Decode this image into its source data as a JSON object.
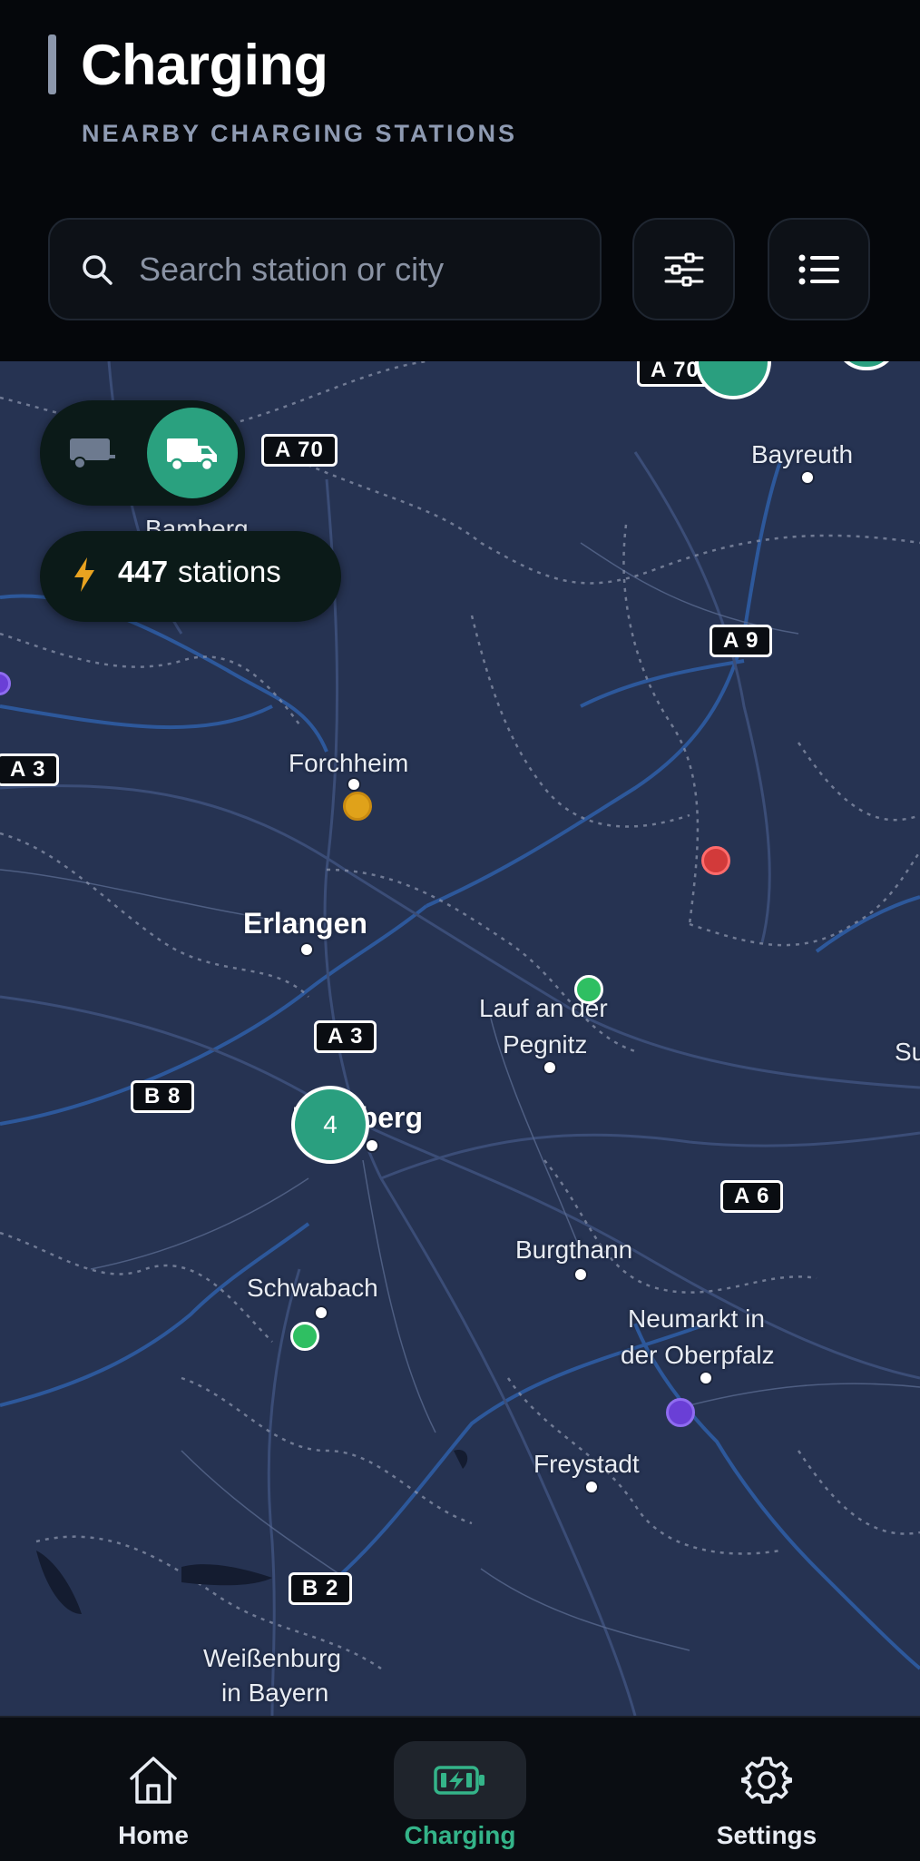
{
  "header": {
    "title": "Charging",
    "subtitle": "NEARBY CHARGING STATIONS"
  },
  "search": {
    "placeholder": "Search station or city",
    "value": ""
  },
  "toolbar": {
    "filter_icon": "sliders-icon",
    "list_icon": "list-icon"
  },
  "vehicle_toggle": {
    "options": [
      {
        "icon": "trailer-icon",
        "active": false
      },
      {
        "icon": "truck-icon",
        "active": true
      }
    ]
  },
  "station_count": {
    "value": "447",
    "label": "stations",
    "icon": "bolt-icon"
  },
  "map": {
    "cities": [
      "Bayreuth",
      "Bamberg",
      "Forchheim",
      "Erlangen",
      "Lauf an der",
      "Pegnitz",
      "Nürnberg",
      "Schwabach",
      "Burgthann",
      "Neumarkt in",
      "der Oberpfalz",
      "Freystadt",
      "Weißenburg",
      "in Bayern",
      "Su"
    ],
    "roads": [
      "A 70",
      "A 70",
      "A 9",
      "A 3",
      "A 3",
      "B 8",
      "A 6",
      "B 2"
    ],
    "cluster_count": "4",
    "marker_colors": {
      "available": "#2fbf62",
      "busy": "#e0a21a",
      "offline": "#d23a3a",
      "other": "#6a3fd6",
      "cluster": "#2a9f7f"
    }
  },
  "nav": {
    "items": [
      {
        "label": "Home",
        "icon": "home-icon",
        "active": false
      },
      {
        "label": "Charging",
        "icon": "battery-charging-icon",
        "active": true
      },
      {
        "label": "Settings",
        "icon": "gear-icon",
        "active": false
      }
    ]
  }
}
